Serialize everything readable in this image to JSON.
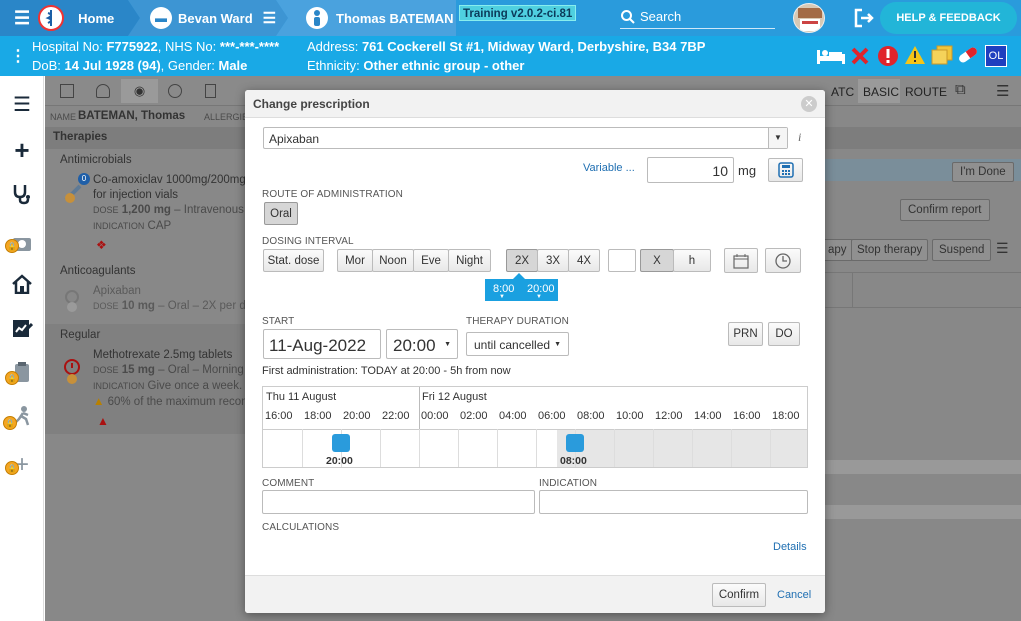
{
  "topbar": {
    "home_label": "Home",
    "ward_label": "Bevan Ward",
    "patient_label": "Thomas BATEMAN",
    "training_label": "Training v2.0.2-ci.81",
    "search_placeholder": "Search",
    "help_label": "HELP & FEEDBACK"
  },
  "patient": {
    "hospital_label": "Hospital No:",
    "hospital_no": "F775922",
    "nhs_label": ", NHS No:",
    "nhs_no": "***-***-****",
    "dob_label": "DoB:",
    "dob": "14 Jul 1928 (94)",
    "gender_label": ", Gender:",
    "gender": "Male",
    "address_label": "Address:",
    "address": "761 Cockerell St #1, Midway Ward, Derbyshire, B34 7BP",
    "ethnicity_label": "Ethnicity:",
    "ethnicity": "Other ethnic group - other",
    "ol_badge": "OL"
  },
  "background": {
    "name_label": "NAME",
    "name": "BATEMAN, Thomas",
    "allergies_label": "ALLERGIES",
    "therapies_header": "Therapies",
    "group_antimicrobials": "Antimicrobials",
    "drug1_name": "Co-amoxiclav 1000mg/200mg",
    "drug1_form": "for injection vials",
    "drug1_dose_label": "DOSE",
    "drug1_dose": "1,200 mg",
    "drug1_route": "– Intravenous -",
    "drug1_ind_label": "INDICATION",
    "drug1_ind": "CAP",
    "drug1_badge": "0",
    "group_anticoag": "Anticoagulants",
    "drug2_name": "Apixaban",
    "drug2_dose_label": "DOSE",
    "drug2_dose": "10 mg",
    "drug2_route": "– Oral – 2X per da",
    "group_regular": "Regular",
    "drug3_name": "Methotrexate 2.5mg tablets",
    "drug3_dose_label": "DOSE",
    "drug3_dose": "15 mg",
    "drug3_route": "– Oral – Morning -",
    "drug3_ind_label": "INDICATION",
    "drug3_ind": "Give once a week.",
    "drug3_warning": "60% of the maximum recon",
    "tab_atc": "ATC",
    "tab_basic": "BASIC",
    "tab_route": "ROUTE",
    "im_done": "I'm Done",
    "confirm_report": "Confirm report",
    "apy": "apy",
    "stop_therapy": "Stop therapy",
    "suspend": "Suspend"
  },
  "modal": {
    "title": "Change prescription",
    "medication": "Apixaban",
    "variable_link": "Variable ...",
    "dose_value": "10",
    "dose_unit": "mg",
    "route_label": "ROUTE OF ADMINISTRATION",
    "route_oral": "Oral",
    "dosing_label": "DOSING INTERVAL",
    "stat_dose": "Stat. dose",
    "mor": "Mor",
    "noon": "Noon",
    "eve": "Eve",
    "night": "Night",
    "x2": "2X",
    "x3": "3X",
    "x4": "4X",
    "x_label": "X",
    "h_label": "h",
    "time1": "8:00",
    "time2": "20:00",
    "start_label": "START",
    "start_date": "11-Aug-2022",
    "start_time": "20:00",
    "duration_label": "THERAPY DURATION",
    "duration_value": "until cancelled",
    "prn": "PRN",
    "do": "DO",
    "first_admin": "First administration: TODAY at 20:00 - 5h from now",
    "timeline": {
      "day1": "Thu 11 August",
      "day2": "Fri 12 August",
      "hours": [
        "16:00",
        "18:00",
        "20:00",
        "22:00",
        "00:00",
        "02:00",
        "04:00",
        "06:00",
        "08:00",
        "10:00",
        "12:00",
        "14:00",
        "16:00",
        "18:00"
      ],
      "dose1_time": "20:00",
      "dose2_time": "08:00"
    },
    "comment_label": "COMMENT",
    "indication_label": "INDICATION",
    "calculations_label": "CALCULATIONS",
    "details_link": "Details",
    "confirm": "Confirm",
    "cancel": "Cancel"
  },
  "colors": {
    "topbar": "#2a9bdc",
    "patient_bar": "#19a9e6",
    "accent": "#2a9bdc",
    "help_button": "#22b5d8",
    "danger": "#e0242b",
    "warning": "#f5c518",
    "ol_badge": "#1f3fbf"
  }
}
